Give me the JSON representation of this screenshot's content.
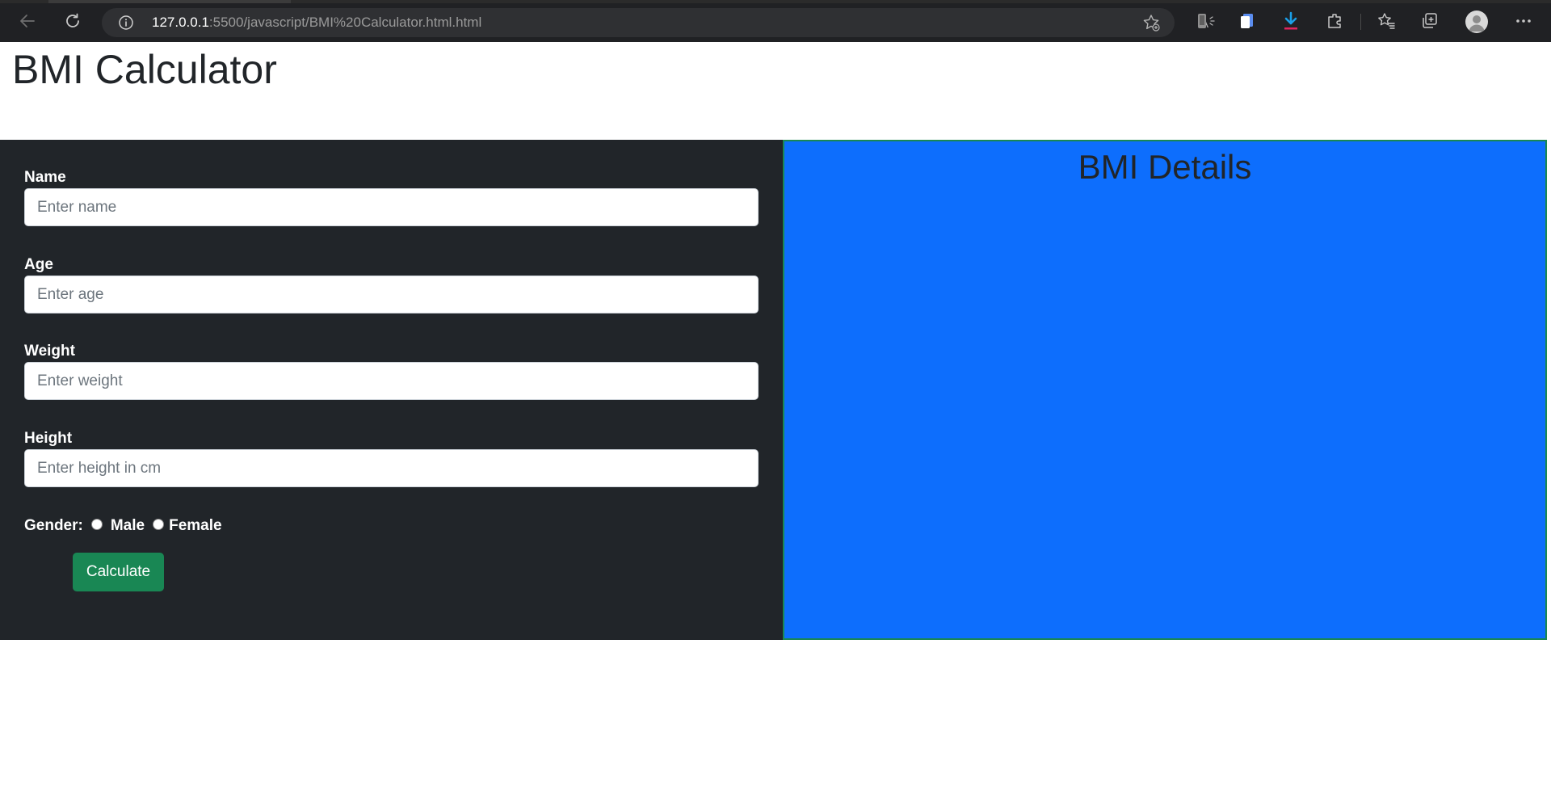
{
  "browser": {
    "url_host": "127.0.0.1",
    "url_rest": ":5500/javascript/BMI%20Calculator.html.html",
    "icons": [
      "back-icon",
      "reload-icon",
      "site-info-icon",
      "read-aloud-icon",
      "add-favorite-icon",
      "phone-icon",
      "collections-icon",
      "download-icon",
      "extensions-icon",
      "favorites-icon",
      "collections-tab-icon",
      "profile-avatar",
      "more-icon"
    ]
  },
  "page": {
    "title": "BMI Calculator"
  },
  "form": {
    "name_label": "Name",
    "name_placeholder": "Enter name",
    "age_label": "Age",
    "age_placeholder": "Enter age",
    "weight_label": "Weight",
    "weight_placeholder": "Enter weight",
    "height_label": "Height",
    "height_placeholder": "Enter height in cm",
    "gender_label": "Gender:",
    "gender_options": [
      "Male",
      "Female"
    ],
    "calculate_label": "Calculate"
  },
  "details": {
    "title": "BMI Details"
  },
  "colors": {
    "form_bg": "#212529",
    "details_bg": "#0d6efd",
    "details_border": "#198754",
    "button_bg": "#198754"
  }
}
